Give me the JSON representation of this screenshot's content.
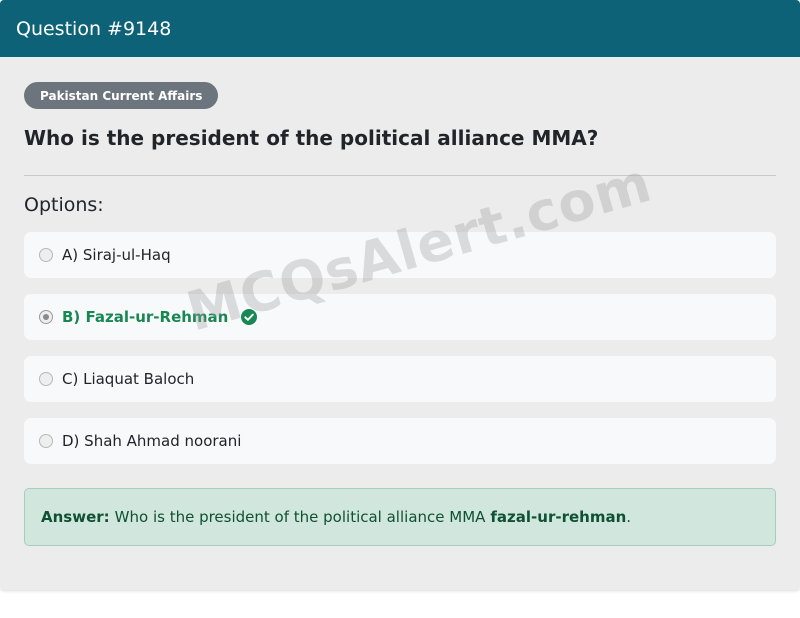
{
  "header": {
    "title": "Question #9148"
  },
  "category_badge": "Pakistan Current Affairs",
  "question": "Who is the president of the political alliance MMA?",
  "options_label": "Options:",
  "options": [
    {
      "label": "A) Siraj-ul-Haq",
      "selected": false,
      "correct": false
    },
    {
      "label": "B) Fazal-ur-Rehman",
      "selected": true,
      "correct": true
    },
    {
      "label": "C) Liaquat Baloch",
      "selected": false,
      "correct": false
    },
    {
      "label": "D) Shah Ahmad noorani",
      "selected": false,
      "correct": false
    }
  ],
  "answer": {
    "label": "Answer:",
    "text": "Who is the president of the political alliance MMA",
    "key": "fazal-ur-rehman",
    "suffix": "."
  },
  "watermark": "MCQsAlert.com",
  "colors": {
    "header": "#0d6277",
    "correct": "#198754",
    "answer_bg": "#d1e7dd"
  },
  "icons": {
    "correct": "check-circle-icon"
  }
}
